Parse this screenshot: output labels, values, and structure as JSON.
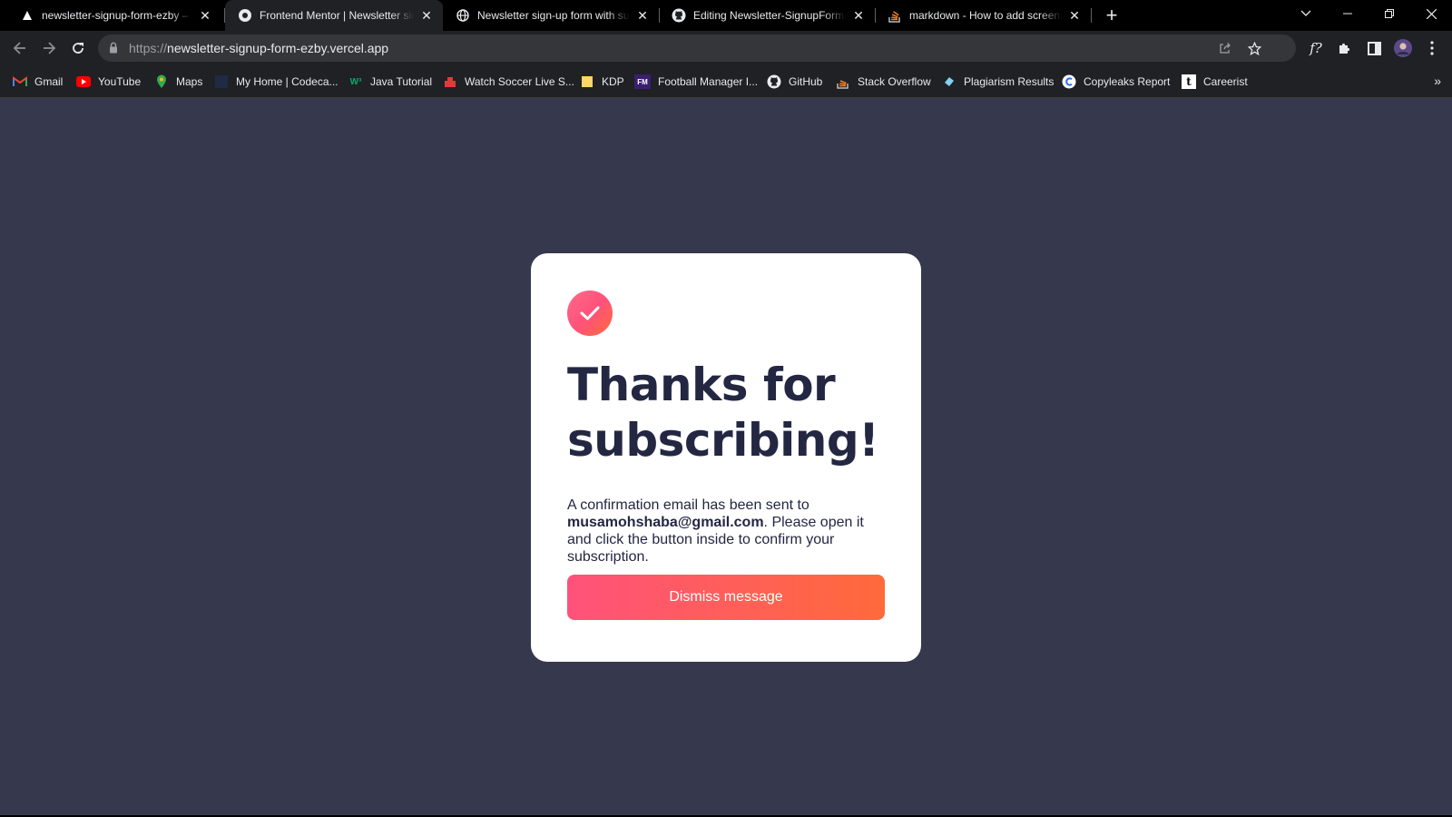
{
  "browser": {
    "tabs": [
      {
        "title": "newsletter-signup-form-ezby – Overview",
        "favicon": "vercel-triangle-icon"
      },
      {
        "title": "Frontend Mentor | Newsletter sign-up form",
        "favicon": "frontend-mentor-icon",
        "active": true
      },
      {
        "title": "Newsletter sign-up form with success message",
        "favicon": "globe-icon"
      },
      {
        "title": "Editing Newsletter-SignupForm/README.md",
        "favicon": "github-icon"
      },
      {
        "title": "markdown - How to add screenshot",
        "favicon": "stackoverflow-icon"
      }
    ],
    "url_scheme": "https://",
    "url_host": "newsletter-signup-form-ezby.vercel.app",
    "bookmarks": [
      {
        "label": "Gmail",
        "icon": "gmail-icon"
      },
      {
        "label": "YouTube",
        "icon": "youtube-icon"
      },
      {
        "label": "Maps",
        "icon": "maps-icon"
      },
      {
        "label": "My Home | Codeca...",
        "icon": "codecademy-icon"
      },
      {
        "label": "Java Tutorial",
        "icon": "w3-icon"
      },
      {
        "label": "Watch Soccer Live S...",
        "icon": "soccer-icon"
      },
      {
        "label": "KDP",
        "icon": "folder-icon"
      },
      {
        "label": "Football Manager I...",
        "icon": "fm-icon"
      },
      {
        "label": "GitHub",
        "icon": "github-icon"
      },
      {
        "label": "Stack Overflow",
        "icon": "stackoverflow-icon"
      },
      {
        "label": "Plagiarism Results",
        "icon": "plagiarism-icon"
      },
      {
        "label": "Copyleaks Report",
        "icon": "copyleaks-icon"
      },
      {
        "label": "Careerist",
        "icon": "careerist-icon"
      }
    ]
  },
  "card": {
    "title_line1": "Thanks for",
    "title_line2": "subscribing!",
    "text_before": "A confirmation email has been sent to ",
    "email": "musamohshaba@gmail.com",
    "text_after": ". Please open it and click the button inside to confirm your subscription.",
    "button_label": "Dismiss message"
  },
  "colors": {
    "page_bg": "#36384d",
    "card_bg": "#ffffff",
    "text_dark": "#242742",
    "accent_start": "#ff527b",
    "accent_end": "#ff6a3a"
  }
}
